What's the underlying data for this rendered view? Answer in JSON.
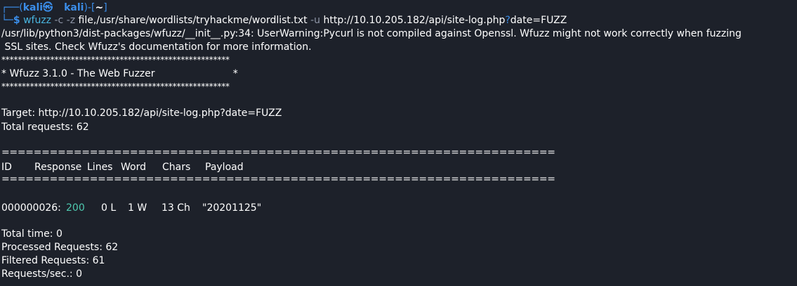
{
  "prompt": {
    "corner_top": "┌──(",
    "user": "kali",
    "skull": "㉿",
    "host": "kali",
    "mid": ")-[",
    "dir": "~",
    "close": "]",
    "corner_bottom": "└─",
    "dollar": "$"
  },
  "command": {
    "name": "wfuzz",
    "opt_c": "-c",
    "opt_z": "-z",
    "z_value": "file,/usr/share/wordlists/tryhackme/wordlist.txt",
    "opt_u": "-u",
    "url_base": "http://10.10.205.182/api/site-log.php",
    "url_q": "?",
    "url_param": "date=FUZZ"
  },
  "warning": {
    "line1": "/usr/lib/python3/dist-packages/wfuzz/__init__.py:34: UserWarning:Pycurl is not compiled against Openssl. Wfuzz might not work correctly when fuzzing",
    "line2": " SSL sites. Check Wfuzz's documentation for more information."
  },
  "banner": {
    "stars_top": "********************************************************",
    "title": "* Wfuzz 3.1.0 - The Web Fuzzer                         *",
    "stars_bottom": "********************************************************"
  },
  "info": {
    "target": "Target: http://10.10.205.182/api/site-log.php?date=FUZZ",
    "total": "Total requests: 62"
  },
  "table": {
    "separator": "=====================================================================",
    "headers": {
      "id": "ID",
      "response": "Response",
      "lines": "Lines",
      "word": "Word",
      "chars": "Chars",
      "payload": "Payload"
    },
    "rows": [
      {
        "id": "000000026:",
        "response": "200",
        "lines": "0 L",
        "word": "1 W",
        "chars": "13 Ch",
        "payload": "\"20201125\""
      }
    ]
  },
  "summary": {
    "time": "Total time: 0",
    "processed": "Processed Requests: 62",
    "filtered": "Filtered Requests: 61",
    "rate": "Requests/sec.: 0"
  },
  "colors": {
    "background": "#1d212a",
    "prompt_blue": "#3b8eea",
    "status_green": "#4ec9b0"
  }
}
